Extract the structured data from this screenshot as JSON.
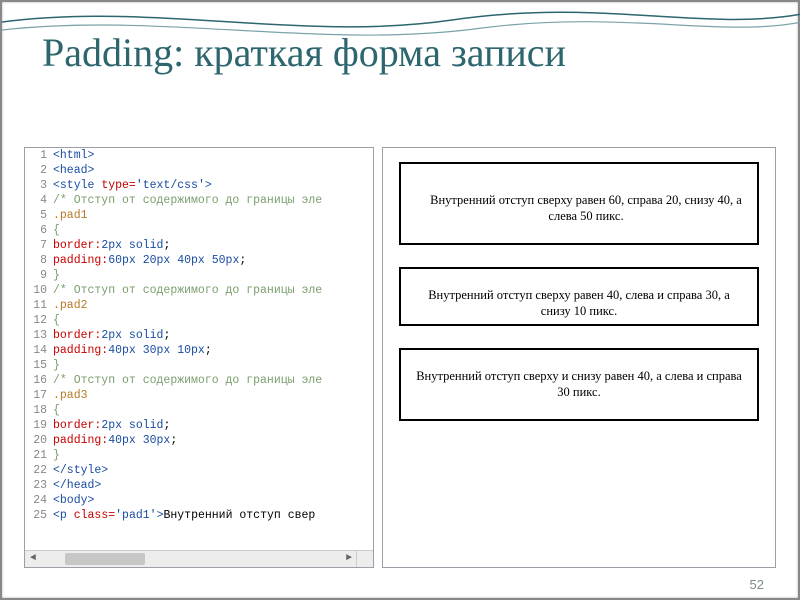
{
  "title": "Padding: краткая форма записи",
  "page_number": "52",
  "code_lines": [
    {
      "n": "1",
      "segs": [
        {
          "t": "<html>",
          "c": "c-tag"
        }
      ]
    },
    {
      "n": "2",
      "segs": [
        {
          "t": "<head>",
          "c": "c-tag"
        }
      ]
    },
    {
      "n": "3",
      "segs": [
        {
          "t": "<style ",
          "c": "c-tag"
        },
        {
          "t": "type=",
          "c": "c-attr"
        },
        {
          "t": "'text/css'",
          "c": "c-str"
        },
        {
          "t": ">",
          "c": "c-tag"
        }
      ]
    },
    {
      "n": "4",
      "segs": [
        {
          "t": "/* Отступ от содержимого до границы эле",
          "c": "c-com"
        }
      ]
    },
    {
      "n": "5",
      "segs": [
        {
          "t": ".pad1",
          "c": "c-sel"
        }
      ]
    },
    {
      "n": "6",
      "segs": [
        {
          "t": "{",
          "c": "c-br"
        }
      ]
    },
    {
      "n": "7",
      "segs": [
        {
          "t": "border:",
          "c": "c-prop"
        },
        {
          "t": "2px solid",
          "c": "c-val"
        },
        {
          "t": ";",
          "c": ""
        }
      ]
    },
    {
      "n": "8",
      "segs": [
        {
          "t": "padding:",
          "c": "c-prop"
        },
        {
          "t": "60px 20px 40px 50px",
          "c": "c-val"
        },
        {
          "t": ";",
          "c": ""
        }
      ]
    },
    {
      "n": "9",
      "segs": [
        {
          "t": "}",
          "c": "c-br"
        }
      ]
    },
    {
      "n": "10",
      "segs": [
        {
          "t": "/* Отступ от содержимого до границы эле",
          "c": "c-com"
        }
      ]
    },
    {
      "n": "11",
      "segs": [
        {
          "t": ".pad2",
          "c": "c-sel"
        }
      ]
    },
    {
      "n": "12",
      "segs": [
        {
          "t": "{",
          "c": "c-br"
        }
      ]
    },
    {
      "n": "13",
      "segs": [
        {
          "t": "border:",
          "c": "c-prop"
        },
        {
          "t": "2px solid",
          "c": "c-val"
        },
        {
          "t": ";",
          "c": ""
        }
      ]
    },
    {
      "n": "14",
      "segs": [
        {
          "t": "padding:",
          "c": "c-prop"
        },
        {
          "t": "40px 30px 10px",
          "c": "c-val"
        },
        {
          "t": ";",
          "c": ""
        }
      ]
    },
    {
      "n": "15",
      "segs": [
        {
          "t": "}",
          "c": "c-br"
        }
      ]
    },
    {
      "n": "16",
      "segs": [
        {
          "t": "/* Отступ от содержимого до границы эле",
          "c": "c-com"
        }
      ]
    },
    {
      "n": "17",
      "segs": [
        {
          "t": ".pad3",
          "c": "c-sel"
        }
      ]
    },
    {
      "n": "18",
      "segs": [
        {
          "t": "{",
          "c": "c-br"
        }
      ]
    },
    {
      "n": "19",
      "segs": [
        {
          "t": "border:",
          "c": "c-prop"
        },
        {
          "t": "2px solid",
          "c": "c-val"
        },
        {
          "t": ";",
          "c": ""
        }
      ]
    },
    {
      "n": "20",
      "segs": [
        {
          "t": "padding:",
          "c": "c-prop"
        },
        {
          "t": "40px 30px",
          "c": "c-val"
        },
        {
          "t": ";",
          "c": ""
        }
      ]
    },
    {
      "n": "21",
      "segs": [
        {
          "t": "}",
          "c": "c-br"
        }
      ]
    },
    {
      "n": "22",
      "segs": [
        {
          "t": "</style>",
          "c": "c-tag"
        }
      ]
    },
    {
      "n": "23",
      "segs": [
        {
          "t": "</head>",
          "c": "c-tag"
        }
      ]
    },
    {
      "n": "24",
      "segs": [
        {
          "t": "<body>",
          "c": "c-tag"
        }
      ]
    },
    {
      "n": "25",
      "segs": [
        {
          "t": "<p ",
          "c": "c-tag"
        },
        {
          "t": "class=",
          "c": "c-attr"
        },
        {
          "t": "'pad1'",
          "c": "c-str"
        },
        {
          "t": ">",
          "c": "c-tag"
        },
        {
          "t": "Внутренний отступ свер",
          "c": ""
        }
      ]
    }
  ],
  "preview": {
    "box1": "Внутренний отступ сверху равен 60, справа 20, снизу 40, а слева 50 пикс.",
    "box2": "Внутренний отступ сверху равен 40, слева и справа 30, а снизу 10 пикс.",
    "box3": "Внутренний отступ сверху и снизу равен 40, а слева и справа 30 пикс."
  }
}
